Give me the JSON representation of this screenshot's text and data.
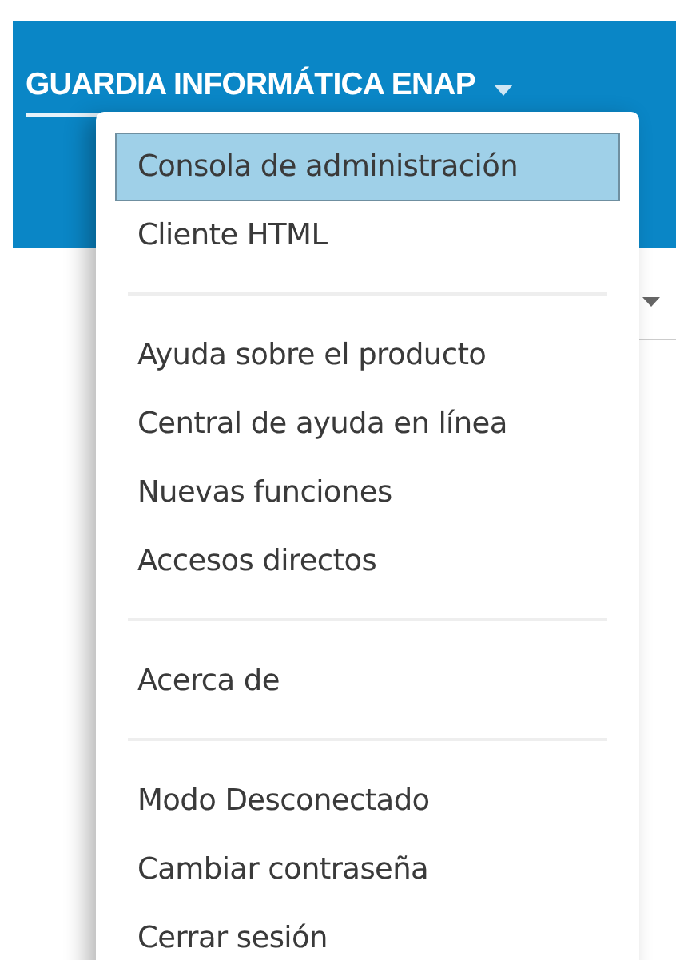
{
  "header": {
    "title": "GUARDIA INFORMÁTICA ENAP"
  },
  "menu": {
    "groups": [
      {
        "items": [
          {
            "label": "Consola de administración",
            "selected": true
          },
          {
            "label": "Cliente HTML",
            "selected": false
          }
        ]
      },
      {
        "items": [
          {
            "label": "Ayuda sobre el producto",
            "selected": false
          },
          {
            "label": "Central de ayuda en línea",
            "selected": false
          },
          {
            "label": "Nuevas funciones",
            "selected": false
          },
          {
            "label": "Accesos directos",
            "selected": false
          }
        ]
      },
      {
        "items": [
          {
            "label": "Acerca de",
            "selected": false
          }
        ]
      },
      {
        "items": [
          {
            "label": "Modo Desconectado",
            "selected": false
          },
          {
            "label": "Cambiar contraseña",
            "selected": false
          },
          {
            "label": "Cerrar sesión",
            "selected": false
          }
        ]
      }
    ]
  }
}
